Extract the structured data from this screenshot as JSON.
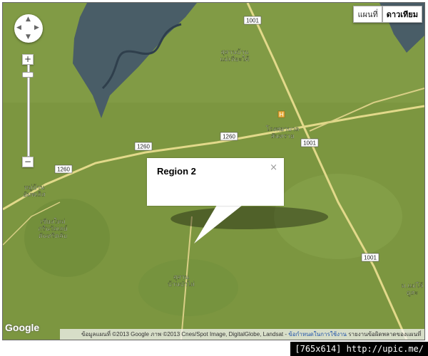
{
  "map": {
    "colors": {
      "base": "#7c9640",
      "dark_region": "#44586a",
      "road": "#e2d98a"
    },
    "road_labels": [
      "1001",
      "1001",
      "1001",
      "1260",
      "1260",
      "1260"
    ],
    "place_labels": [
      "สุสานบ้าน แม่เหียะใต้",
      "โรงพยาบาล สันทราย",
      "หมู่บ้าน อัมพเลิส",
      "เชียงใหม่ กรีนวัลเลย์ คันทรีคลับ",
      "สุสาน บ้านป่าไผ่",
      "ม.แม่โจ้ ดูสะ"
    ],
    "icon": "marker-h-icon"
  },
  "controls": {
    "pan_icon": "pan-control-icon",
    "zoom_in": "+",
    "zoom_out": "−",
    "zoom_level": 0.09
  },
  "map_type": {
    "map_label": "แผนที่",
    "satellite_label": "ดาวเทียม",
    "active": "satellite"
  },
  "info_window": {
    "title": "Region 2",
    "close": "×"
  },
  "footer_bar": {
    "logo": "Google",
    "attribution": "ข้อมูลแผนที่ ©2013 Google ภาพ ©2013 Cnes/Spot Image, DigitalGlobe, Landsat - ",
    "terms": "ข้อกำหนดในการใช้งาน",
    "report": "รายงานข้อผิดพลาดของแผนที่"
  },
  "watermark": "[765x614] http://upic.me/"
}
